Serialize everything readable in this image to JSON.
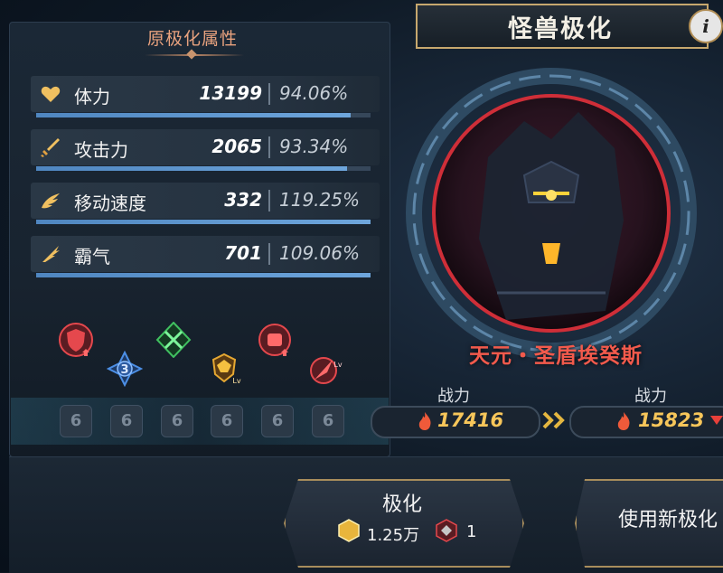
{
  "header": {
    "title": "怪兽极化",
    "info_label": "i"
  },
  "section_title": "原极化属性",
  "stats": [
    {
      "name": "体力",
      "value": "13199",
      "percent": "94.06%",
      "fill": 0.94,
      "icon": "heart-icon"
    },
    {
      "name": "攻击力",
      "value": "2065",
      "percent": "93.34%",
      "fill": 0.93,
      "icon": "sword-icon"
    },
    {
      "name": "移动速度",
      "value": "332",
      "percent": "119.25%",
      "fill": 1.0,
      "icon": "wing-icon"
    },
    {
      "name": "霸气",
      "value": "701",
      "percent": "109.06%",
      "fill": 1.0,
      "icon": "claw-icon"
    }
  ],
  "skills": [
    {
      "icon": "shield-up-icon",
      "color": "#e5484d"
    },
    {
      "icon": "rank-3-emblem-icon",
      "label": "3",
      "color": "#4c8fe6"
    },
    {
      "icon": "crossed-swords-icon",
      "color": "#40c060"
    },
    {
      "icon": "gold-crest-lv-icon",
      "label": "Lv",
      "color": "#e6a832"
    },
    {
      "icon": "fist-badge-icon",
      "color": "#e5484d"
    },
    {
      "icon": "comet-lv-icon",
      "label": "Lv",
      "color": "#e5484d"
    }
  ],
  "locked_slots": [
    "6",
    "6",
    "6",
    "6",
    "6",
    "6"
  ],
  "monster": {
    "name": "天元・圣盾埃癸斯"
  },
  "power": {
    "label_left": "战力",
    "value_left": "17416",
    "label_right": "战力",
    "value_right": "15823"
  },
  "buttons": {
    "polarize_label": "极化",
    "cost_gold": "1.25万",
    "cost_item": "1",
    "use_new_label": "使用新极化"
  },
  "colors": {
    "accent_gold": "#c7a86e",
    "power_value": "#f7c65a",
    "monster_name": "#f25a4c",
    "section_title": "#e8a27e"
  }
}
